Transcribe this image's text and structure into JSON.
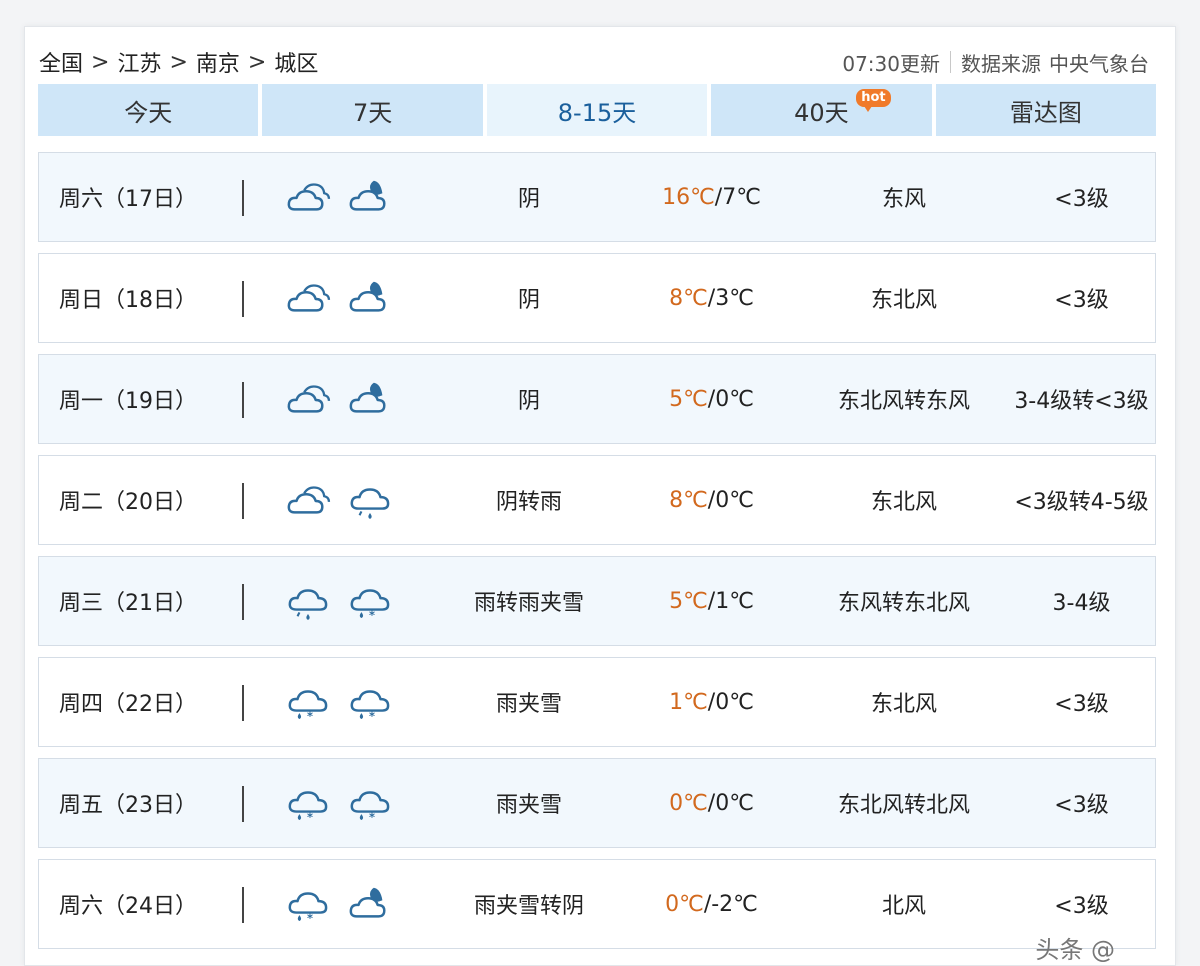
{
  "breadcrumb": [
    "全国",
    "江苏",
    "南京",
    "城区"
  ],
  "breadcrumb_sep": ">",
  "meta": {
    "update": "07:30更新",
    "source_label": "数据来源",
    "source": "中央气象台"
  },
  "tabs": [
    {
      "label": "今天"
    },
    {
      "label": "7天"
    },
    {
      "label": "8-15天"
    },
    {
      "label": "40天",
      "badge": "hot"
    },
    {
      "label": "雷达图"
    }
  ],
  "active_tab": "8-15天",
  "forecast": [
    {
      "day": "周六（17日）",
      "icons": [
        "cloudy-icon",
        "cloudy-night-icon"
      ],
      "desc": "阴",
      "hi": "16℃",
      "lo": "/7℃",
      "wind": "东风",
      "level": "<3级"
    },
    {
      "day": "周日（18日）",
      "icons": [
        "cloudy-icon",
        "cloudy-night-icon"
      ],
      "desc": "阴",
      "hi": "8℃",
      "lo": "/3℃",
      "wind": "东北风",
      "level": "<3级"
    },
    {
      "day": "周一（19日）",
      "icons": [
        "cloudy-icon",
        "cloudy-night-icon"
      ],
      "desc": "阴",
      "hi": "5℃",
      "lo": "/0℃",
      "wind": "东北风转东风",
      "level": "3-4级转<3级"
    },
    {
      "day": "周二（20日）",
      "icons": [
        "cloudy-icon",
        "rain-icon"
      ],
      "desc": "阴转雨",
      "hi": "8℃",
      "lo": "/0℃",
      "wind": "东北风",
      "level": "<3级转4-5级"
    },
    {
      "day": "周三（21日）",
      "icons": [
        "rain-icon",
        "sleet-icon"
      ],
      "desc": "雨转雨夹雪",
      "hi": "5℃",
      "lo": "/1℃",
      "wind": "东风转东北风",
      "level": "3-4级"
    },
    {
      "day": "周四（22日）",
      "icons": [
        "sleet-icon",
        "sleet-icon"
      ],
      "desc": "雨夹雪",
      "hi": "1℃",
      "lo": "/0℃",
      "wind": "东北风",
      "level": "<3级"
    },
    {
      "day": "周五（23日）",
      "icons": [
        "sleet-icon",
        "sleet-icon"
      ],
      "desc": "雨夹雪",
      "hi": "0℃",
      "lo": "/0℃",
      "wind": "东北风转北风",
      "level": "<3级"
    },
    {
      "day": "周六（24日）",
      "icons": [
        "sleet-icon",
        "cloudy-night-icon"
      ],
      "desc": "雨夹雪转阴",
      "hi": "0℃",
      "lo": "/-2℃",
      "wind": "北风",
      "level": "<3级"
    }
  ],
  "colors": {
    "tab_bg": "#cfe6f8",
    "tab_active_bg": "#e8f4fc",
    "hi_temp": "#d2691e",
    "icon": "#2f6d9e"
  },
  "watermark": "头条 @"
}
